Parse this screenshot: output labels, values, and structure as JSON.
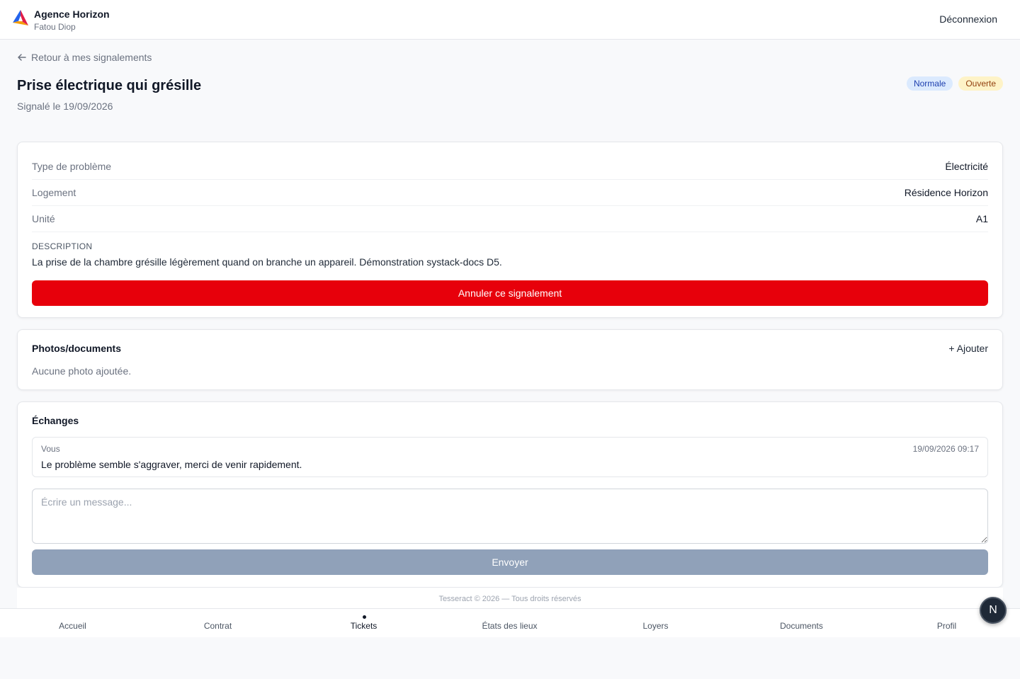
{
  "header": {
    "brand_name": "Agence Horizon",
    "user_name": "Fatou Diop",
    "logout_label": "Déconnexion"
  },
  "back_link": "Retour à mes signalements",
  "ticket": {
    "title": "Prise électrique qui grésille",
    "reported_on": "Signalé le 19/09/2026",
    "priority_badge": "Normale",
    "status_badge": "Ouverte",
    "details": [
      {
        "label": "Type de problème",
        "value": "Électricité"
      },
      {
        "label": "Logement",
        "value": "Résidence Horizon"
      },
      {
        "label": "Unité",
        "value": "A1"
      }
    ],
    "description_label": "DESCRIPTION",
    "description": "La prise de la chambre grésille légèrement quand on branche un appareil. Démonstration systack-docs D5.",
    "cancel_label": "Annuler ce signalement"
  },
  "photos": {
    "title": "Photos/documents",
    "add_label": "+ Ajouter",
    "empty_text": "Aucune photo ajoutée."
  },
  "exchanges": {
    "title": "Échanges",
    "messages": [
      {
        "author": "Vous",
        "time": "19/09/2026 09:17",
        "text": "Le problème semble s'aggraver, merci de venir rapidement."
      }
    ],
    "input_placeholder": "Écrire un message...",
    "send_label": "Envoyer"
  },
  "footer": "Tesseract © 2026 — Tous droits réservés",
  "nav": {
    "items": [
      "Accueil",
      "Contrat",
      "Tickets",
      "États des lieux",
      "Loyers",
      "Documents",
      "Profil"
    ],
    "active": "Tickets"
  },
  "floating_badge": "N",
  "colors": {
    "danger": "#e7000b",
    "disabled_button": "#90a1b9",
    "badge_blue_bg": "#dbeafe",
    "badge_yellow_bg": "#fef3c7"
  }
}
